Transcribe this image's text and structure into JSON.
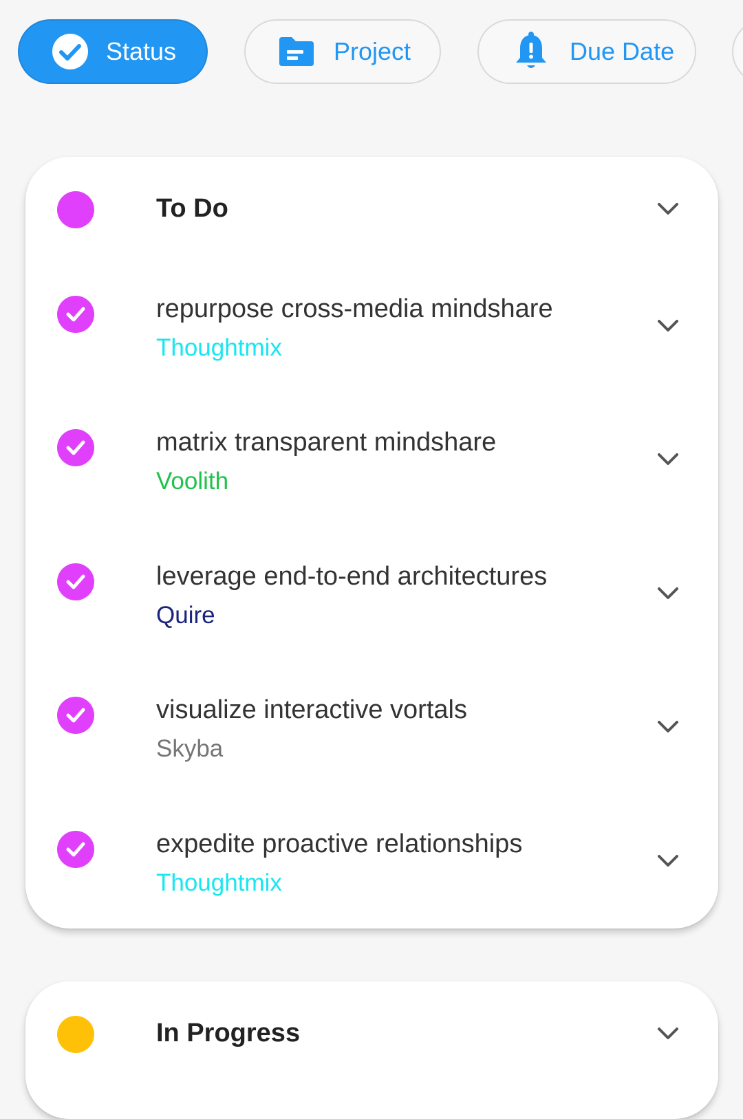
{
  "filters": [
    {
      "label": "Status",
      "icon": "check-circle-icon",
      "active": true
    },
    {
      "label": "Project",
      "icon": "folder-icon",
      "active": false
    },
    {
      "label": "Due Date",
      "icon": "bell-alert-icon",
      "active": false
    }
  ],
  "colors": {
    "accent": "#2196f3",
    "todo": "#e040fb",
    "in_progress": "#ffc107"
  },
  "groups": [
    {
      "title": "To Do",
      "color": "#e040fb",
      "tasks": [
        {
          "title": "repurpose cross-media mindshare",
          "project": "Thoughtmix",
          "project_color": "#18e6f0"
        },
        {
          "title": "matrix transparent mindshare",
          "project": "Voolith",
          "project_color": "#1fc24a"
        },
        {
          "title": "leverage end-to-end architectures",
          "project": "Quire",
          "project_color": "#1a237e"
        },
        {
          "title": "visualize interactive vortals",
          "project": "Skyba",
          "project_color": "#757575"
        },
        {
          "title": "expedite proactive relationships",
          "project": "Thoughtmix",
          "project_color": "#18e6f0"
        }
      ]
    },
    {
      "title": "In Progress",
      "color": "#ffc107",
      "tasks": []
    }
  ]
}
